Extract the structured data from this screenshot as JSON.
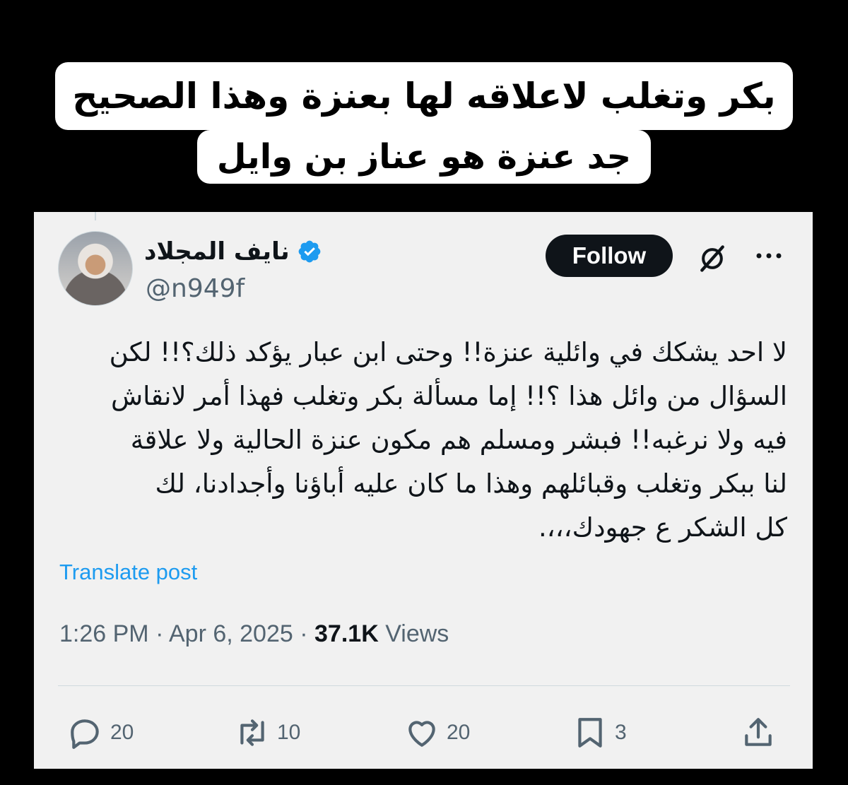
{
  "caption": {
    "line1": "بكر وتغلب لاعلاقه لها بعنزة وهذا الصحيح",
    "line2": "جد عنزة هو عناز بن وايل"
  },
  "tweet": {
    "author_name": "نايف المجلاد",
    "handle": "@n949f",
    "verified": true,
    "follow_label": "Follow",
    "text": "لا احد يشكك في وائلية عنزة!! وحتى ابن عبار يؤكد ذلك؟!! لكن\nالسؤال من وائل هذا ؟!! إما مسألة بكر وتغلب فهذا أمر لانقاش\nفيه ولا نرغبه!! فبشر ومسلم هم مكون عنزة الحالية ولا علاقة\nلنا ببكر وتغلب وقبائلهم وهذا ما كان عليه أباؤنا وأجدادنا، لك\nكل الشكر ع جهودك،،،.",
    "translate_label": "Translate post",
    "time": "1:26 PM",
    "date": "Apr 6, 2025",
    "views_count": "37.1K",
    "views_label": "Views",
    "actions": {
      "replies": "20",
      "reposts": "10",
      "likes": "20",
      "bookmarks": "3"
    }
  },
  "icons": [
    "verified-badge-icon",
    "grok-icon",
    "more-icon",
    "reply-icon",
    "repost-icon",
    "like-icon",
    "bookmark-icon",
    "share-icon"
  ],
  "colors": {
    "accent": "#1d9bf0",
    "text": "#0f1419",
    "muted": "#536471",
    "card_bg": "#f1f1f1"
  }
}
